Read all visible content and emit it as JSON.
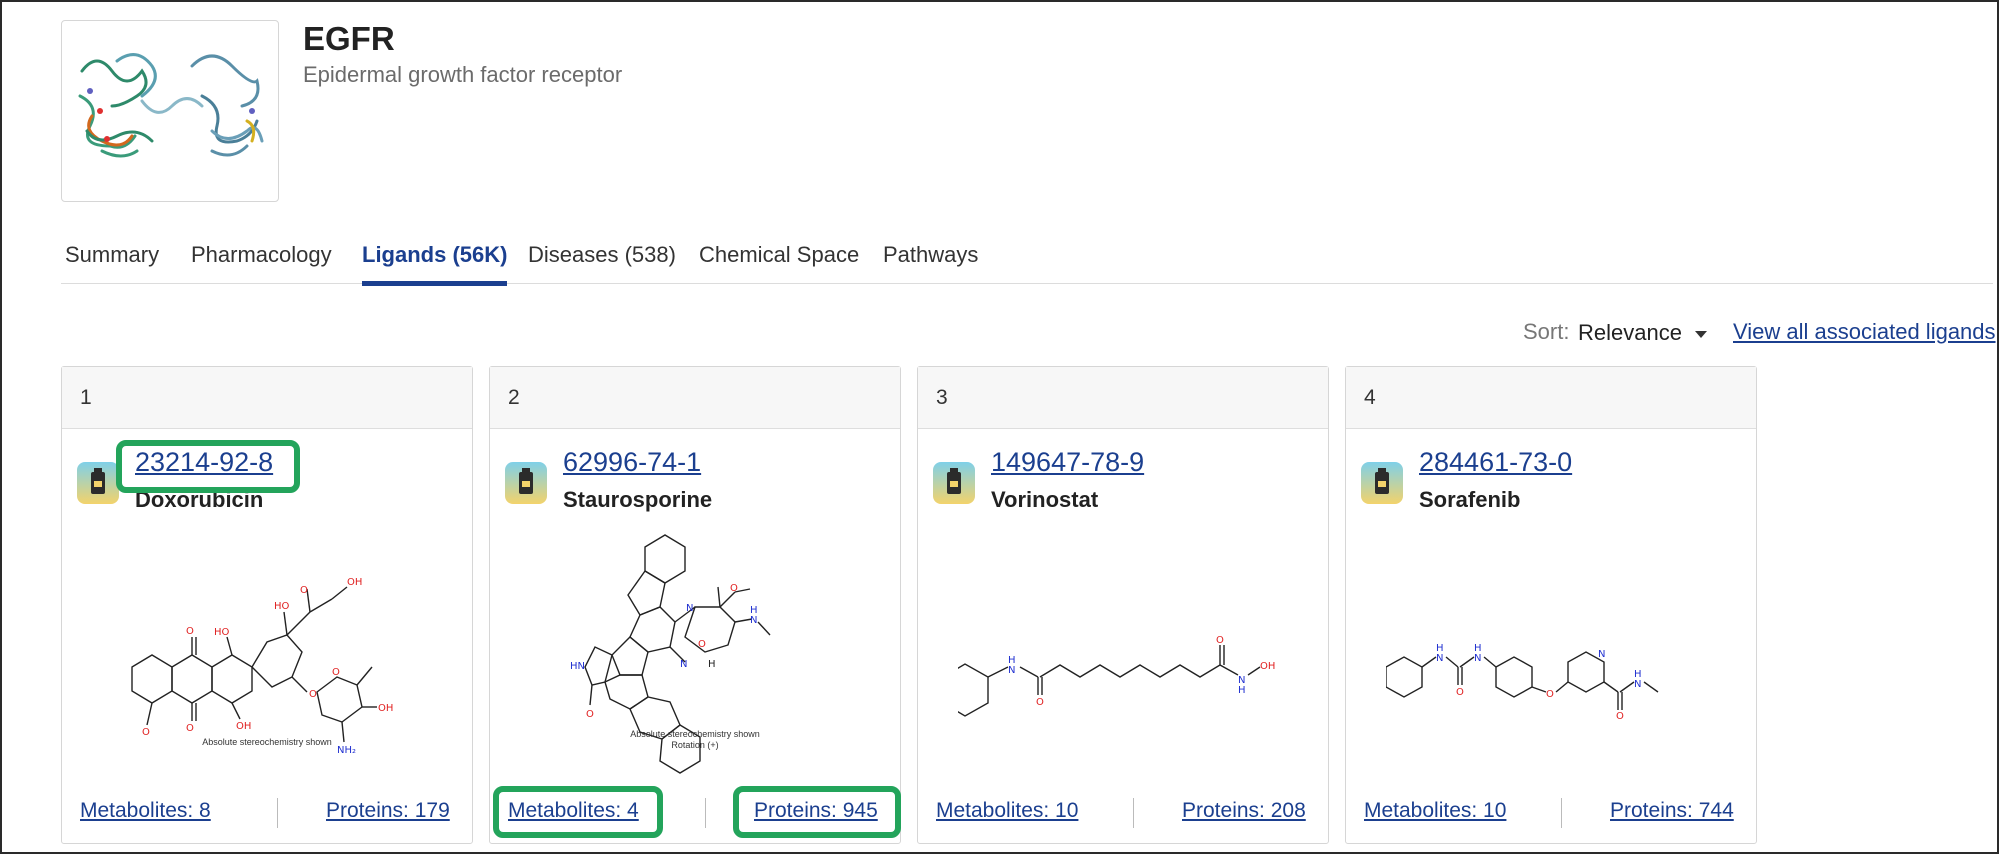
{
  "header": {
    "title": "EGFR",
    "subtitle": "Epidermal growth factor receptor"
  },
  "tabs": [
    {
      "label": "Summary",
      "active": false
    },
    {
      "label": "Pharmacology",
      "active": false
    },
    {
      "label": "Ligands (56K)",
      "active": true
    },
    {
      "label": "Diseases (538)",
      "active": false
    },
    {
      "label": "Chemical Space",
      "active": false
    },
    {
      "label": "Pathways",
      "active": false
    }
  ],
  "sort": {
    "label": "Sort:",
    "value": "Relevance",
    "view_all": "View all associated ligands"
  },
  "cards": [
    {
      "rank": "1",
      "cas": "23214-92-8",
      "name": "Doxorubicin",
      "stereo": "Absolute stereochemistry shown",
      "metabolites": "Metabolites: 8",
      "proteins": "Proteins: 179"
    },
    {
      "rank": "2",
      "cas": "62996-74-1",
      "name": "Staurosporine",
      "stereo": "Absolute stereochemistry shown",
      "stereo2": "Rotation (+)",
      "metabolites": "Metabolites: 4",
      "proteins": "Proteins: 945"
    },
    {
      "rank": "3",
      "cas": "149647-78-9",
      "name": "Vorinostat",
      "metabolites": "Metabolites: 10",
      "proteins": "Proteins: 208"
    },
    {
      "rank": "4",
      "cas": "284461-73-0",
      "name": "Sorafenib",
      "metabolites": "Metabolites: 10",
      "proteins": "Proteins: 744"
    }
  ],
  "colors": {
    "link": "#1b3f8f",
    "highlight": "#23a45b",
    "oxygen": "#e02020",
    "nitrogen": "#2030d0",
    "chlorine": "#2a9a2a"
  }
}
